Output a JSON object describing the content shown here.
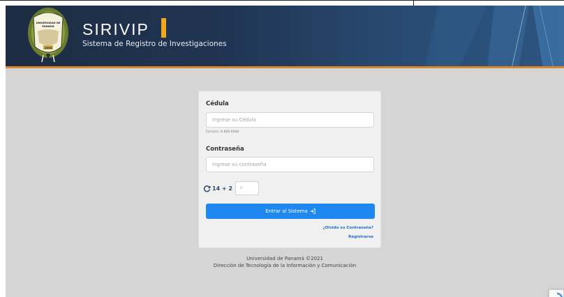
{
  "header": {
    "brand_title": "SIRIVIP",
    "brand_subtitle": "Sistema de Registro de Investigaciones",
    "seal_text_top": "UNIVERSIDAD DE",
    "seal_text_mid": "PANAMÁ",
    "seal_year": "1935",
    "colors": {
      "header_bg": "#1d2c43",
      "accent_bar": "#f0a61e",
      "underline": "#d9892b"
    }
  },
  "login": {
    "cedula_label": "Cédula",
    "cedula_placeholder": "Ingrese su Cédula",
    "cedula_value": "",
    "cedula_help": "Ejemplo: 8-888-8888",
    "password_label": "Contraseña",
    "password_placeholder": "Ingrese su contraseña",
    "password_value": "",
    "captcha_question": "14 + 2",
    "captcha_placeholder": "#",
    "captcha_value": "",
    "submit_label": "Entrar al Sistema",
    "forgot_link": "¿Olvido su Contraseña?",
    "register_link": "Registrarse",
    "colors": {
      "button": "#1e88f0",
      "link": "#1e6fd0",
      "card_bg": "#f0f0f0"
    }
  },
  "footer": {
    "line1": "Universidad de Panamá ©2021",
    "line2": "Dirección de Tecnología de la Información y Comunicación"
  },
  "icons": [
    "refresh-icon",
    "login-icon",
    "recaptcha-icon",
    "university-seal"
  ]
}
